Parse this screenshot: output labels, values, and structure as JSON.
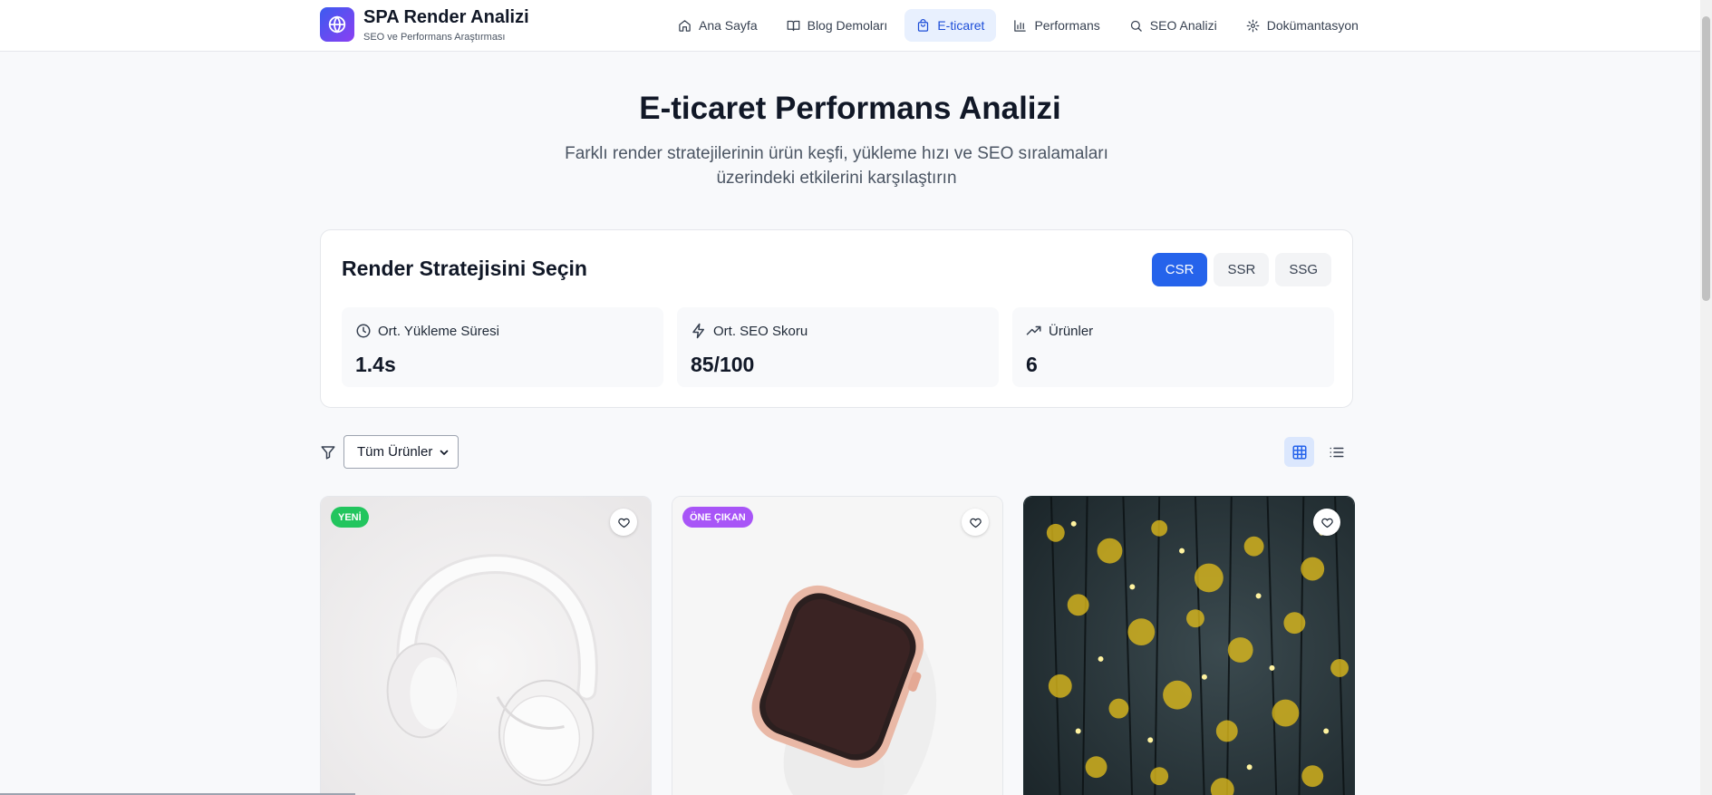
{
  "header": {
    "title": "SPA Render Analizi",
    "subtitle": "SEO ve Performans Araştırması",
    "nav": [
      {
        "label": "Ana Sayfa",
        "icon": "home-icon",
        "active": false
      },
      {
        "label": "Blog Demoları",
        "icon": "book-icon",
        "active": false
      },
      {
        "label": "E-ticaret",
        "icon": "shopping-bag-icon",
        "active": true
      },
      {
        "label": "Performans",
        "icon": "bar-chart-icon",
        "active": false
      },
      {
        "label": "SEO Analizi",
        "icon": "search-icon",
        "active": false
      },
      {
        "label": "Dokümantasyon",
        "icon": "gear-icon",
        "active": false
      }
    ]
  },
  "hero": {
    "title": "E-ticaret Performans Analizi",
    "subtitle": "Farklı render stratejilerinin ürün keşfi, yükleme hızı ve SEO sıralamaları üzerindeki etkilerini karşılaştırın"
  },
  "strategy": {
    "title": "Render Stratejisini Seçin",
    "options": [
      "CSR",
      "SSR",
      "SSG"
    ],
    "selected": "CSR",
    "stats": [
      {
        "label": "Ort. Yükleme Süresi",
        "value": "1.4s",
        "icon": "clock-icon"
      },
      {
        "label": "Ort. SEO Skoru",
        "value": "85/100",
        "icon": "zap-icon"
      },
      {
        "label": "Ürünler",
        "value": "6",
        "icon": "trending-up-icon"
      }
    ]
  },
  "filter": {
    "selected": "Tüm Ürünler",
    "view_mode": "grid"
  },
  "products": [
    {
      "badge": "YENİ",
      "badge_color": "#22c55e",
      "image": "white headphones"
    },
    {
      "badge": "ÖNE ÇIKAN",
      "badge_color": "#a855f7",
      "image": "smartwatch"
    },
    {
      "badge": "",
      "badge_color": "",
      "image": "string lights"
    }
  ],
  "colors": {
    "accent": "#2563eb",
    "nav_active_bg": "#e8f0fe",
    "page_bg": "#f8f9fb"
  }
}
